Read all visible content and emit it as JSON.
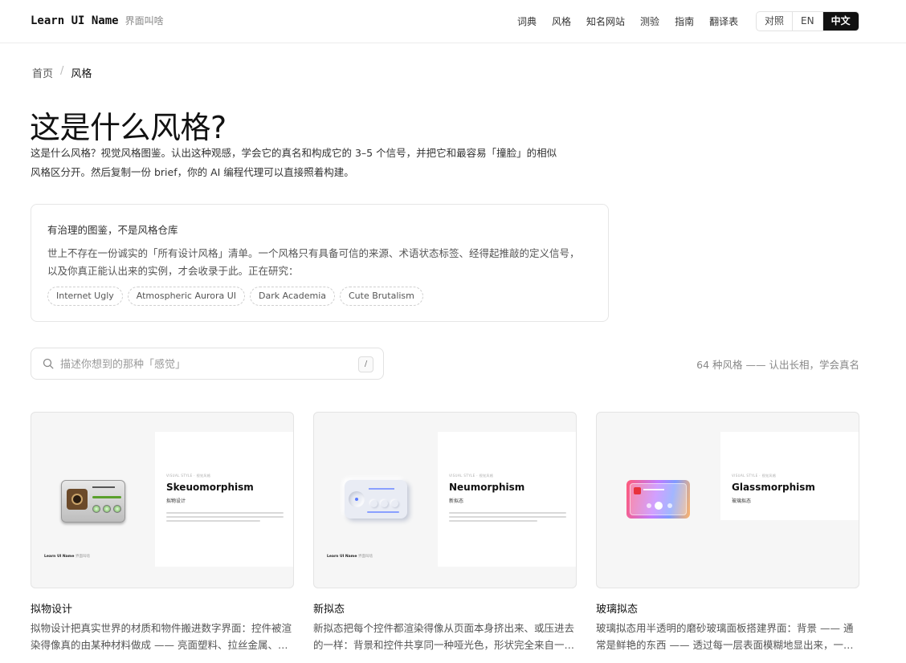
{
  "header": {
    "brand_main": "Learn UI Name",
    "brand_sub": "界面叫啥",
    "nav": [
      "词典",
      "风格",
      "知名网站",
      "测验",
      "指南",
      "翻译表"
    ],
    "lang": [
      "对照",
      "EN",
      "中文"
    ],
    "active_lang": "中文"
  },
  "breadcrumb": {
    "home": "首页",
    "separator": "/",
    "current": "风格"
  },
  "page": {
    "title": "这是什么风格?",
    "intro": "这是什么风格？视觉风格图鉴。认出这种观感，学会它的真名和构成它的 3–5 个信号，并把它和最容易「撞脸」的相似风格区分开。然后复制一份 brief，你的 AI 编程代理可以直接照着构建。"
  },
  "notice": {
    "title": "有治理的图鉴，不是风格仓库",
    "body": "世上不存在一份诚实的「所有设计风格」清单。一个风格只有具备可信的来源、术语状态标签、经得起推敲的定义信号，以及你真正能认出来的实例，才会收录于此。正在研究：",
    "chips": [
      "Internet Ugly",
      "Atmospheric Aurora UI",
      "Dark Academia",
      "Cute Brutalism"
    ]
  },
  "search": {
    "placeholder": "描述你想到的那种「感觉」",
    "shortcut": "/",
    "icon": "search-icon"
  },
  "count_text": "64 种风格 —— 认出长相，学会真名",
  "cards": [
    {
      "title": "拟物设计",
      "desc": "拟物设计把真实世界的材质和物件搬进数字界面：控件被渲染得像真的由某种材料做成 —— 亮面塑料、拉丝金属、皮革、纸张，带着光影、纹理和可供性。",
      "thumb_kicker": "VISUAL STYLE · 视觉风格",
      "thumb_title": "Skeuomorphism",
      "thumb_sub": "拟物设计",
      "thumb_brand": "Learn UI Name",
      "thumb_brand_sub": "界面叫啥"
    },
    {
      "title": "新拟态",
      "desc": "新拟态把每个控件都渲染得像从页面本身挤出来、或压进去的一样：背景和控件共享同一种哑光色，形状完全来自一对柔和的阴影。",
      "thumb_kicker": "VISUAL STYLE · 视觉风格",
      "thumb_title": "Neumorphism",
      "thumb_sub": "新拟态",
      "thumb_brand": "Learn UI Name",
      "thumb_brand_sub": "界面叫啥"
    },
    {
      "title": "玻璃拟态",
      "desc": "玻璃拟态用半透明的磨砂玻璃面板搭建界面：背景 —— 通常是鲜艳的东西 —— 透过每一层表面模糊地显出来，一条细亮边勾出面板轮廓。",
      "thumb_kicker": "VISUAL STYLE · 视觉风格",
      "thumb_title": "Glassmorphism",
      "thumb_sub": "玻璃拟态",
      "thumb_brand": "",
      "thumb_brand_sub": ""
    }
  ]
}
